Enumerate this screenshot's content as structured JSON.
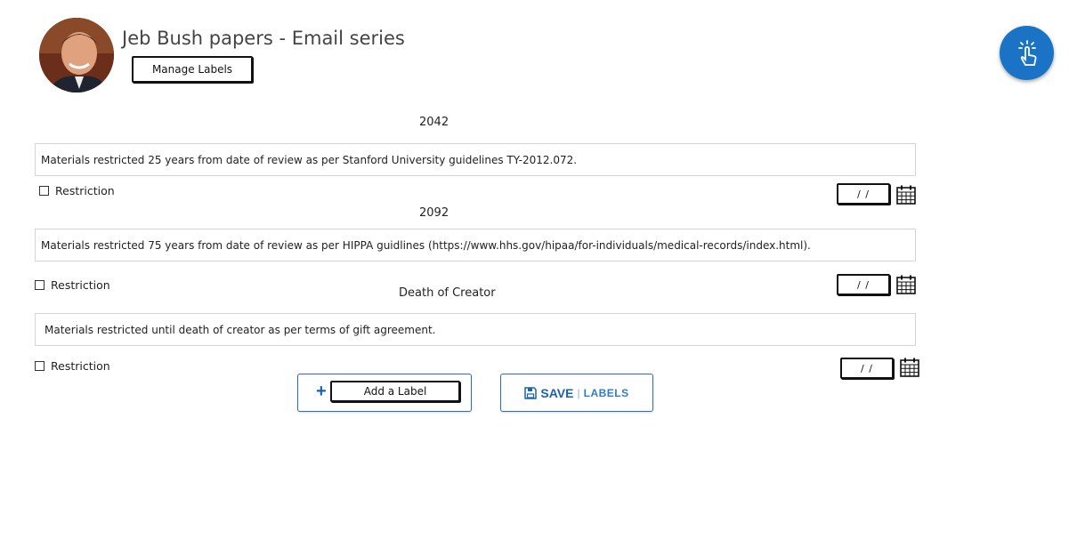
{
  "header": {
    "title": "Jeb Bush papers - Email series",
    "manage_labels": "Manage Labels"
  },
  "entries": [
    {
      "year": "2042",
      "text": "Materials restricted 25 years from date of review as per Stanford University guidelines TY-2012.072.",
      "checkbox_label": "Restriction",
      "date_value": "/ /"
    },
    {
      "year": "2092",
      "text": "Materials restricted 75 years from date of review as per HIPPA guidlines (https://www.hhs.gov/hipaa/for-individuals/medical-records/index.html).",
      "checkbox_label": "Restriction",
      "date_value": "/ /"
    },
    {
      "year": "Death of Creator",
      "text": "Materials restricted until death of creator as per terms of gift agreement.",
      "checkbox_label": "Restriction",
      "date_value": "/ /"
    }
  ],
  "actions": {
    "add_label": "Add a Label",
    "save": "SAVE",
    "save_separator": "|",
    "save_suffix": "LABELS"
  },
  "icons": {
    "fab": "tap-gesture-icon",
    "calendar": "calendar-icon",
    "add": "plus-icon",
    "save": "floppy-disk-icon"
  },
  "colors": {
    "accent": "#1a73c4",
    "button_text": "#1a63ad"
  }
}
